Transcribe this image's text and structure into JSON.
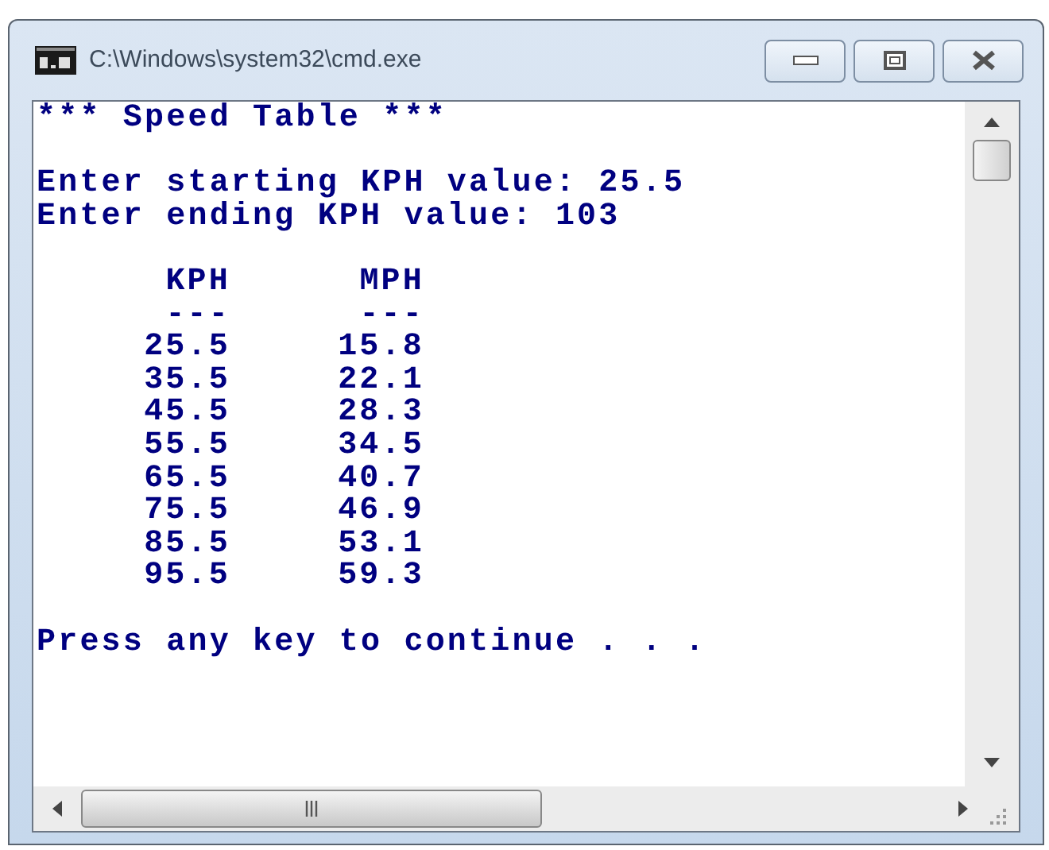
{
  "window": {
    "title": "C:\\Windows\\system32\\cmd.exe"
  },
  "console": {
    "heading": "*** Speed Table ***",
    "prompts": [
      "Enter starting KPH value: 25.5",
      "Enter ending KPH value: 103"
    ],
    "table": {
      "columns": [
        {
          "header": "KPH",
          "rule": "---"
        },
        {
          "header": "MPH",
          "rule": "---"
        }
      ],
      "rows": [
        [
          "25.5",
          "15.8"
        ],
        [
          "35.5",
          "22.1"
        ],
        [
          "45.5",
          "28.3"
        ],
        [
          "55.5",
          "34.5"
        ],
        [
          "65.5",
          "40.7"
        ],
        [
          "75.5",
          "46.9"
        ],
        [
          "85.5",
          "53.1"
        ],
        [
          "95.5",
          "59.3"
        ]
      ]
    },
    "footer": "Press any key to continue . . ."
  }
}
